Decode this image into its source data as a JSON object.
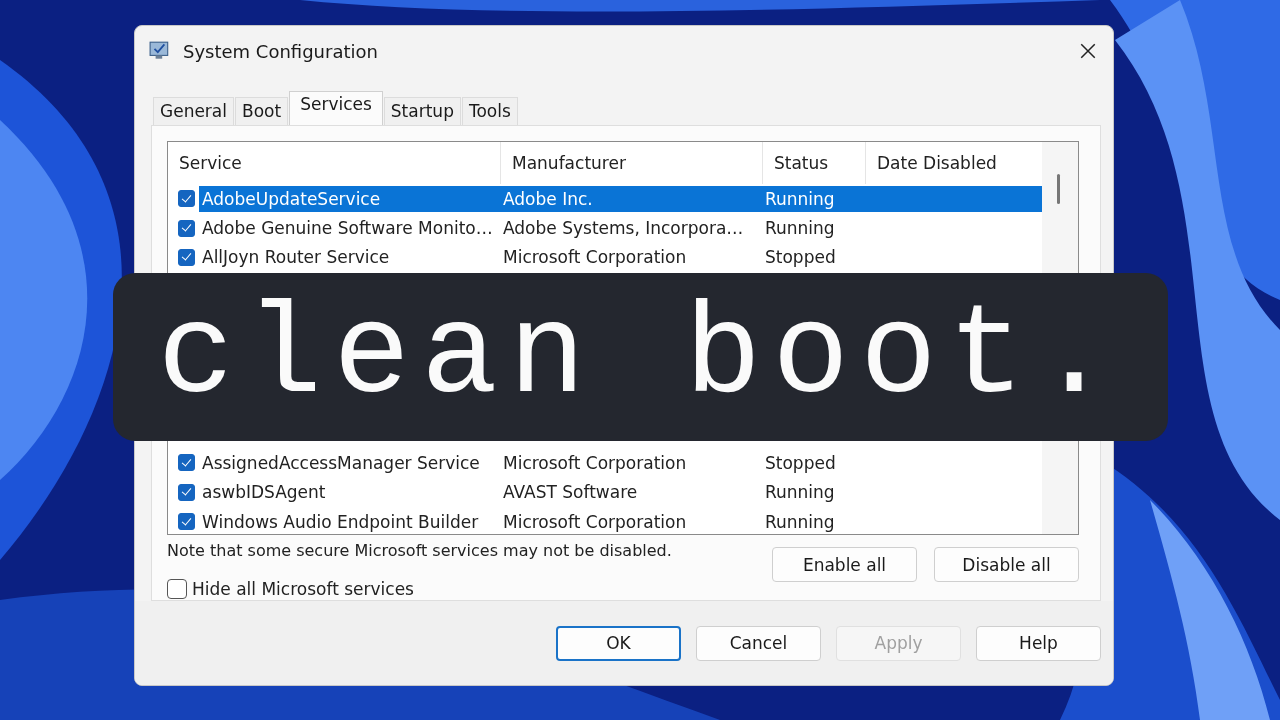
{
  "window": {
    "title": "System Configuration"
  },
  "tabs": [
    {
      "label": "General",
      "selected": false
    },
    {
      "label": "Boot",
      "selected": false
    },
    {
      "label": "Services",
      "selected": true
    },
    {
      "label": "Startup",
      "selected": false
    },
    {
      "label": "Tools",
      "selected": false
    }
  ],
  "services_table": {
    "columns": [
      "Service",
      "Manufacturer",
      "Status",
      "Date Disabled"
    ],
    "rows_above_caption": [
      {
        "service": "AdobeUpdateService",
        "manufacturer": "Adobe Inc.",
        "status": "Running",
        "checked": true,
        "selected": true
      },
      {
        "service": "Adobe Genuine Software Monito…",
        "manufacturer": "Adobe Systems, Incorpora…",
        "status": "Running",
        "checked": true,
        "selected": false
      },
      {
        "service": "AllJoyn Router Service",
        "manufacturer": "Microsoft Corporation",
        "status": "Stopped",
        "checked": true,
        "selected": false
      }
    ],
    "rows_below_caption": [
      {
        "service": "AssignedAccessManager Service",
        "manufacturer": "Microsoft Corporation",
        "status": "Stopped",
        "checked": true,
        "selected": false
      },
      {
        "service": "aswbIDSAgent",
        "manufacturer": "AVAST Software",
        "status": "Running",
        "checked": true,
        "selected": false
      },
      {
        "service": "Windows Audio Endpoint Builder",
        "manufacturer": "Microsoft Corporation",
        "status": "Running",
        "checked": true,
        "selected": false
      }
    ]
  },
  "note": "Note that some secure Microsoft services may not be disabled.",
  "list_buttons": [
    "Enable all",
    "Disable all"
  ],
  "hide_microsoft": {
    "label": "Hide all Microsoft services",
    "checked": false
  },
  "dialog_buttons": [
    {
      "label": "OK",
      "kind": "default",
      "disabled": false
    },
    {
      "label": "Cancel",
      "kind": "normal",
      "disabled": false
    },
    {
      "label": "Apply",
      "kind": "normal",
      "disabled": true
    },
    {
      "label": "Help",
      "kind": "normal",
      "disabled": false
    }
  ],
  "overlay": {
    "caption": "clean boot."
  }
}
